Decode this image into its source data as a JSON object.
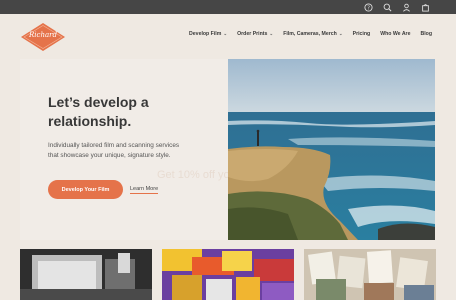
{
  "topbar": {
    "icons": [
      "help-icon",
      "search-icon",
      "account-icon",
      "cart-icon"
    ]
  },
  "brand": {
    "logo_text": "Richard"
  },
  "nav": {
    "items": [
      {
        "label": "Develop Film",
        "dropdown": true
      },
      {
        "label": "Order Prints",
        "dropdown": true
      },
      {
        "label": "Film, Cameras, Merch",
        "dropdown": true
      },
      {
        "label": "Pricing",
        "dropdown": false
      },
      {
        "label": "Who We Are",
        "dropdown": false
      },
      {
        "label": "Blog",
        "dropdown": false
      }
    ]
  },
  "hero": {
    "title": "Let’s develop a relationship.",
    "subtitle": "Individually tailored film and scanning services that showcase your unique, signature style.",
    "primary_button": "Develop Your Film",
    "secondary_link": "Learn More",
    "promo_faint": "Get 10% off yo"
  },
  "colors": {
    "accent": "#e5734a",
    "topbar": "#464646",
    "background": "#efe9e2"
  }
}
